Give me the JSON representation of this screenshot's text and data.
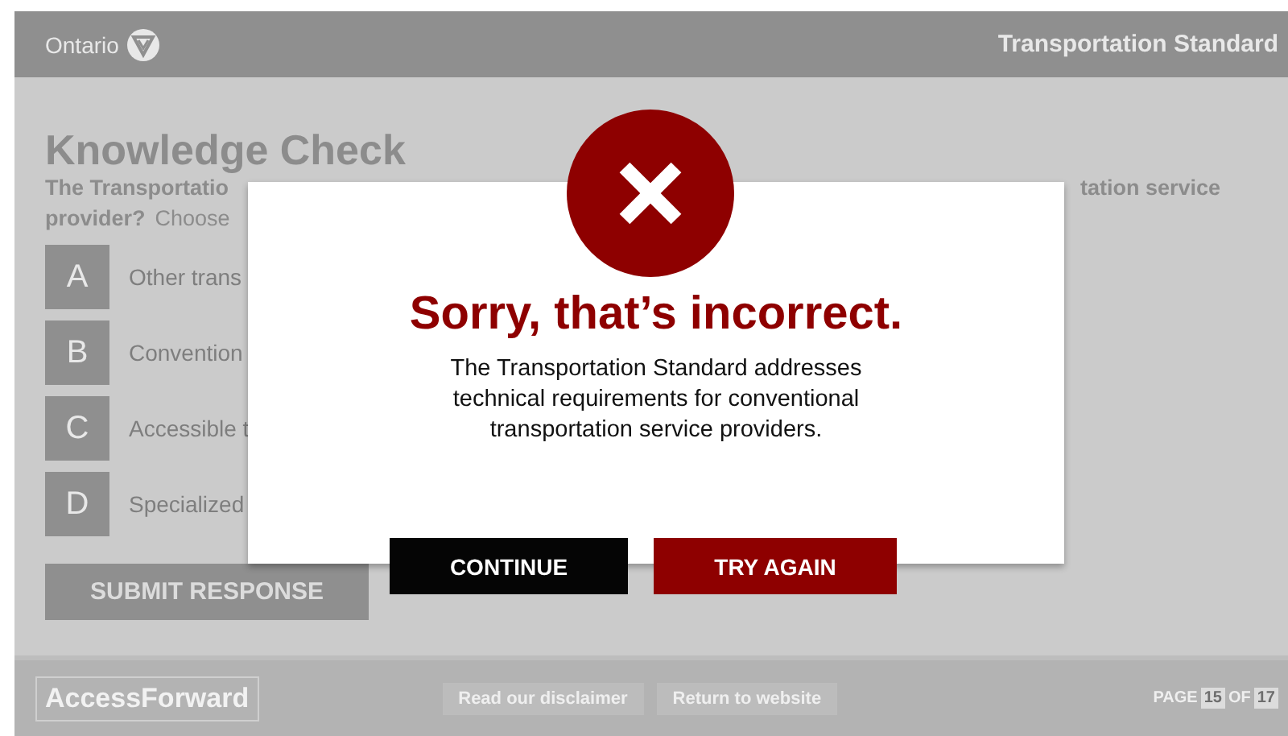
{
  "header": {
    "brand": "Ontario",
    "course_title": "Transportation Standard"
  },
  "content": {
    "title": "Knowledge Check",
    "question_left": "The Transportatio",
    "question_right": "tation service",
    "question_line2_bold": "provider?",
    "question_line2": "Choose",
    "options": [
      {
        "letter": "A",
        "text": "Other trans"
      },
      {
        "letter": "B",
        "text": "Convention"
      },
      {
        "letter": "C",
        "text": "Accessible t"
      },
      {
        "letter": "D",
        "text": "Specialized"
      }
    ],
    "submit": "SUBMIT RESPONSE"
  },
  "dialog": {
    "title": "Sorry, that’s incorrect.",
    "message": "The Transportation Standard addresses technical requirements for conventional transportation service providers.",
    "buttons": [
      {
        "label": "CONTINUE",
        "kind": "dark"
      },
      {
        "label": "TRY AGAIN",
        "kind": "accent"
      }
    ]
  },
  "footer": {
    "logo": "AccessForward",
    "links": [
      "Read our disclaimer",
      "Return to website"
    ],
    "page_label": "PAGE",
    "page_current": "15",
    "page_of": "OF",
    "page_total": "17"
  }
}
